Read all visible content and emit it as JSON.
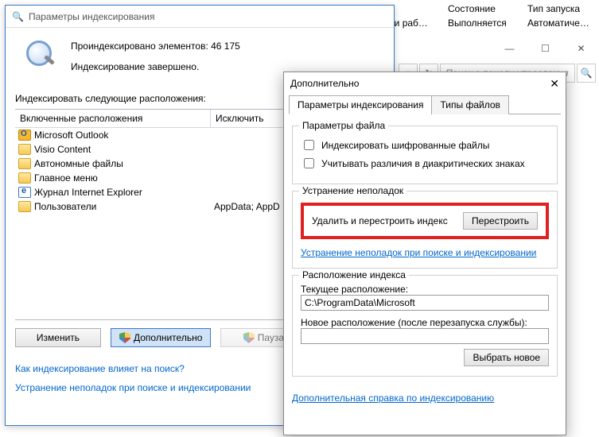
{
  "background": {
    "col_state": "Состояние",
    "col_startup": "Тип запуска",
    "val_workers": "ствами раб…",
    "val_running": "Выполняется",
    "val_auto": "Автоматиче…",
    "min": "—",
    "max": "☐",
    "close": "✕",
    "nav_back": "‹",
    "dd": "▾",
    "refresh": "↻",
    "search_ph": "Поиск в панели управления",
    "search_icon": "🔍"
  },
  "main": {
    "title": "Параметры индексирования",
    "indexed_line": "Проиндексировано элементов: 46 175",
    "done_line": "Индексирование завершено.",
    "locations_label": "Индексировать следующие расположения:",
    "col_included": "Включенные расположения",
    "col_exclude": "Исключить",
    "rows": [
      {
        "name": "Microsoft Outlook",
        "icon": "outlook",
        "exclude": ""
      },
      {
        "name": "Visio Content",
        "icon": "folder",
        "exclude": ""
      },
      {
        "name": "Автономные файлы",
        "icon": "folder",
        "exclude": ""
      },
      {
        "name": "Главное меню",
        "icon": "folder",
        "exclude": ""
      },
      {
        "name": "Журнал Internet Explorer",
        "icon": "ie",
        "exclude": ""
      },
      {
        "name": "Пользователи",
        "icon": "folder",
        "exclude": "AppData; AppD"
      }
    ],
    "btn_change": "Изменить",
    "btn_advanced": "Дополнительно",
    "btn_pause": "Пауза",
    "link_how": "Как индексирование влияет на поиск?",
    "link_trouble": "Устранение неполадок при поиске и индексировании"
  },
  "adv": {
    "title": "Дополнительно",
    "close": "✕",
    "tab_index": "Параметры индексирования",
    "tab_types": "Типы файлов",
    "grp_file": "Параметры файла",
    "chk_encrypt": "Индексировать шифрованные файлы",
    "chk_diacrit": "Учитывать различия в диакритических знаках",
    "grp_trouble": "Устранение неполадок",
    "rebuild_label": "Удалить и перестроить индекс",
    "btn_rebuild": "Перестроить",
    "link_trouble": "Устранение неполадок при поиске и индексировании",
    "grp_location": "Расположение индекса",
    "cur_label": "Текущее расположение:",
    "cur_path": "C:\\ProgramData\\Microsoft",
    "new_label": "Новое расположение (после перезапуска службы):",
    "btn_choose": "Выбрать новое",
    "footer_link": "Дополнительная справка по индексированию"
  }
}
